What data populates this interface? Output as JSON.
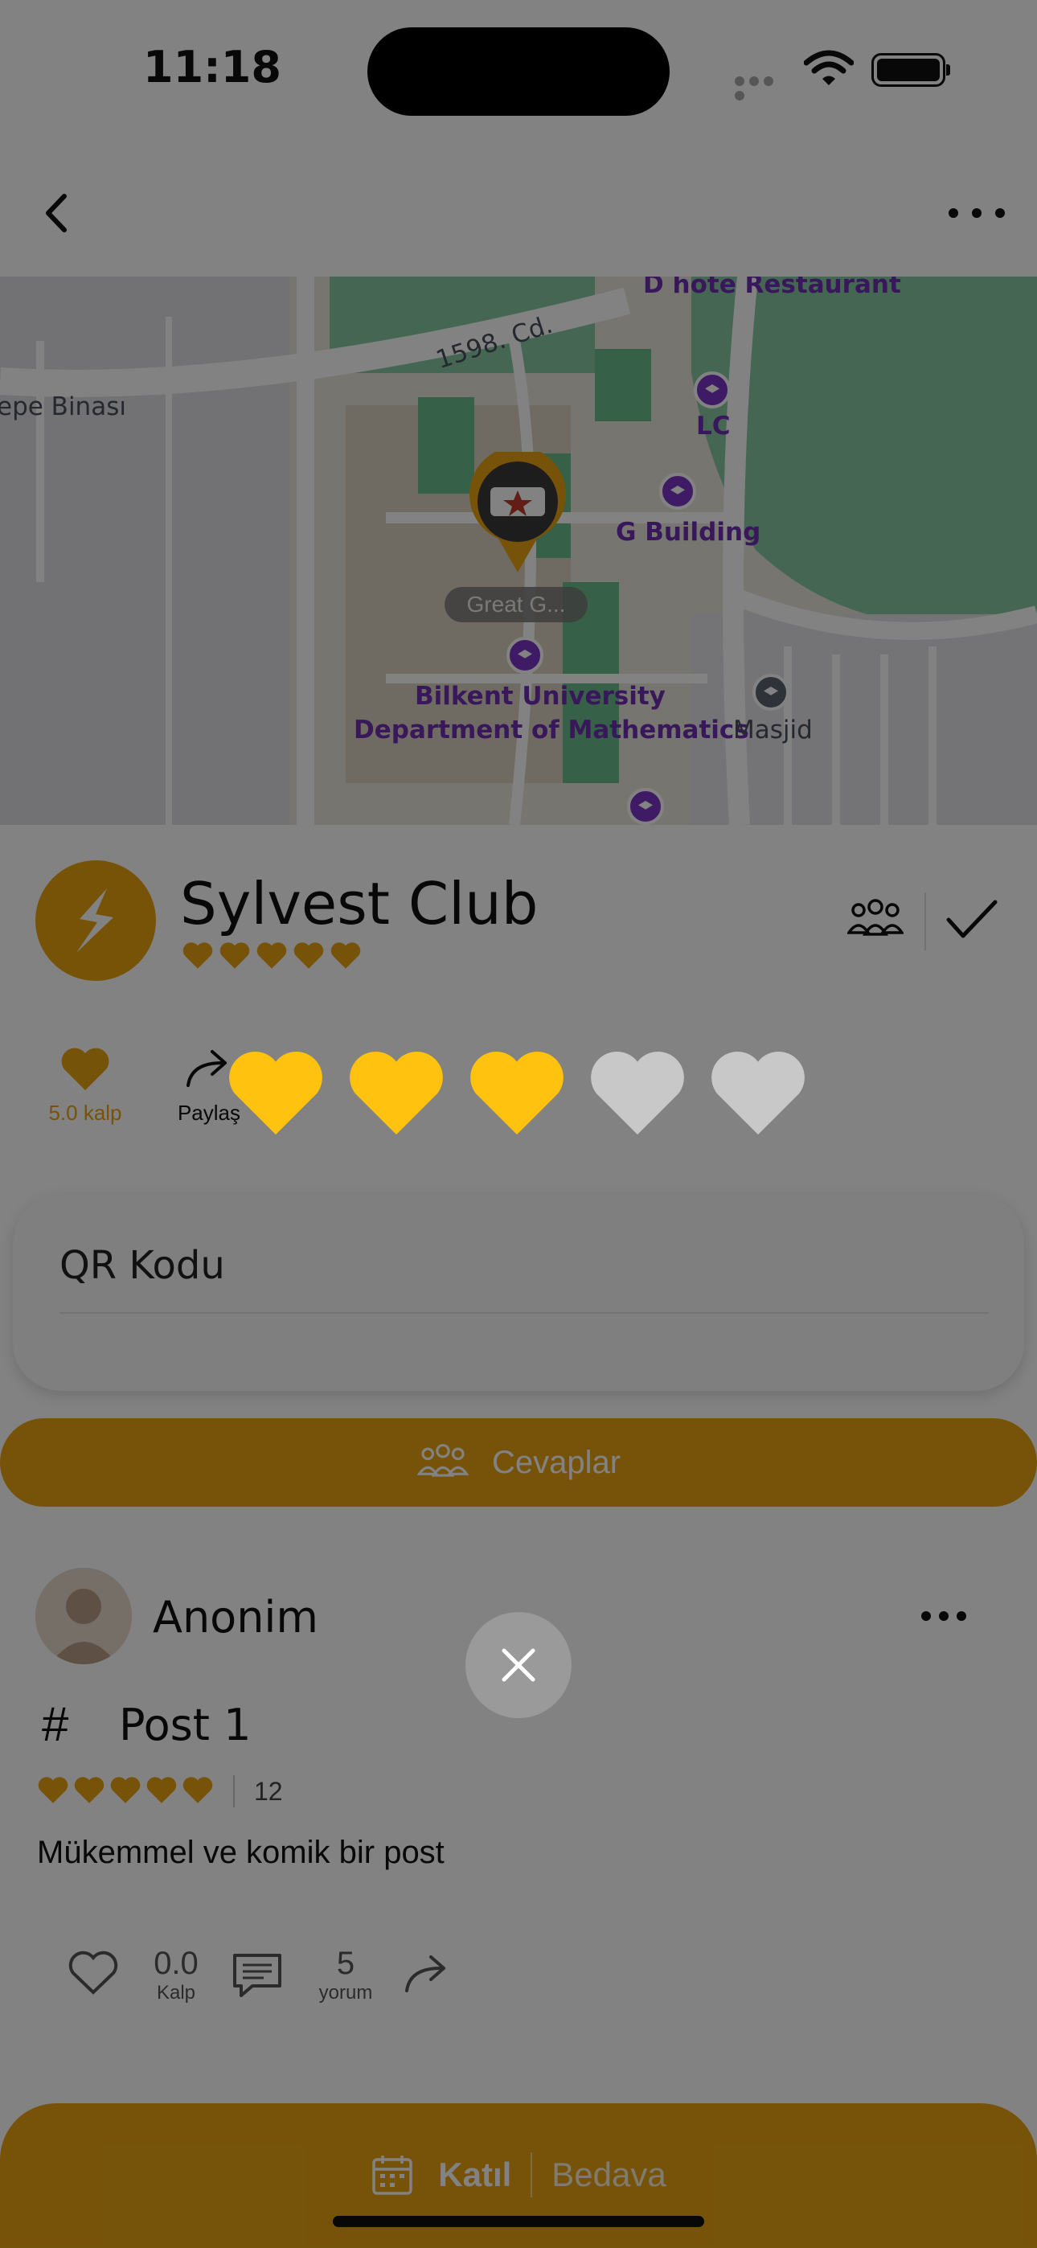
{
  "status_bar": {
    "time": "11:18"
  },
  "map": {
    "labels": {
      "road": "1598. Cd.",
      "restaurant": "D hote Restaurant",
      "west_building": "epe Binası",
      "lc": "LC",
      "g_building": "G Building",
      "dept_line1": "Bilkent University",
      "dept_line2": "Department of Mathematics",
      "masjid": "Masjid",
      "pin_callout": "Great G..."
    },
    "colors": {
      "land": "#e8e4d8",
      "green": "#7cc3a0",
      "road": "#ffffff",
      "poi": "#7a36c4"
    }
  },
  "club": {
    "name": "Sylvest Club",
    "rating_hearts": 5
  },
  "actions": {
    "like_label": "5.0 kalp",
    "share_label": "Paylaş"
  },
  "qr": {
    "title": "QR Kodu"
  },
  "answers_button": {
    "label": "Cevaplar"
  },
  "post": {
    "author": "Anonim",
    "title": "Post 1",
    "rating_hearts": 5,
    "rating_count": "12",
    "body": "Mükemmel ve komik bir post",
    "likes_value": "0.0",
    "likes_caption": "Kalp",
    "comments_value": "5",
    "comments_caption": "yorum"
  },
  "bottom_bar": {
    "join_label": "Katıl",
    "price_label": "Bedava"
  },
  "rating_overlay": {
    "selected": 3,
    "max": 5,
    "filled_color": "#ffc20e",
    "empty_color": "#c8c8c8"
  },
  "colors": {
    "accent": "#e8a412",
    "overlay": "rgba(0,0,0,0.49)"
  }
}
